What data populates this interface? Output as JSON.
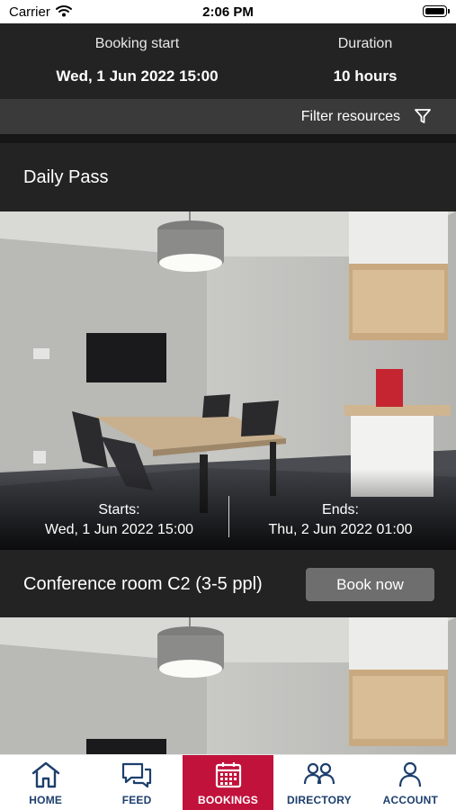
{
  "status_bar": {
    "carrier": "Carrier",
    "time": "2:06 PM"
  },
  "booking": {
    "start_label": "Booking start",
    "start_value": "Wed, 1 Jun 2022 15:00",
    "duration_label": "Duration",
    "duration_value": "10 hours"
  },
  "filter": {
    "label": "Filter resources"
  },
  "section": {
    "title": "Daily Pass"
  },
  "resources": [
    {
      "starts_label": "Starts:",
      "starts_value": "Wed, 1 Jun 2022 15:00",
      "ends_label": "Ends:",
      "ends_value": "Thu, 2 Jun 2022 01:00",
      "name": "Conference room  C2 (3-5 ppl)",
      "book_label": "Book now"
    }
  ],
  "tabs": [
    {
      "label": "HOME",
      "icon": "home-icon"
    },
    {
      "label": "FEED",
      "icon": "chat-icon"
    },
    {
      "label": "BOOKINGS",
      "icon": "calendar-icon",
      "active": true
    },
    {
      "label": "DIRECTORY",
      "icon": "people-icon"
    },
    {
      "label": "ACCOUNT",
      "icon": "person-icon"
    }
  ],
  "colors": {
    "accent": "#c1123b",
    "tab_icon": "#1d3f6e",
    "header_bg": "#232323"
  }
}
